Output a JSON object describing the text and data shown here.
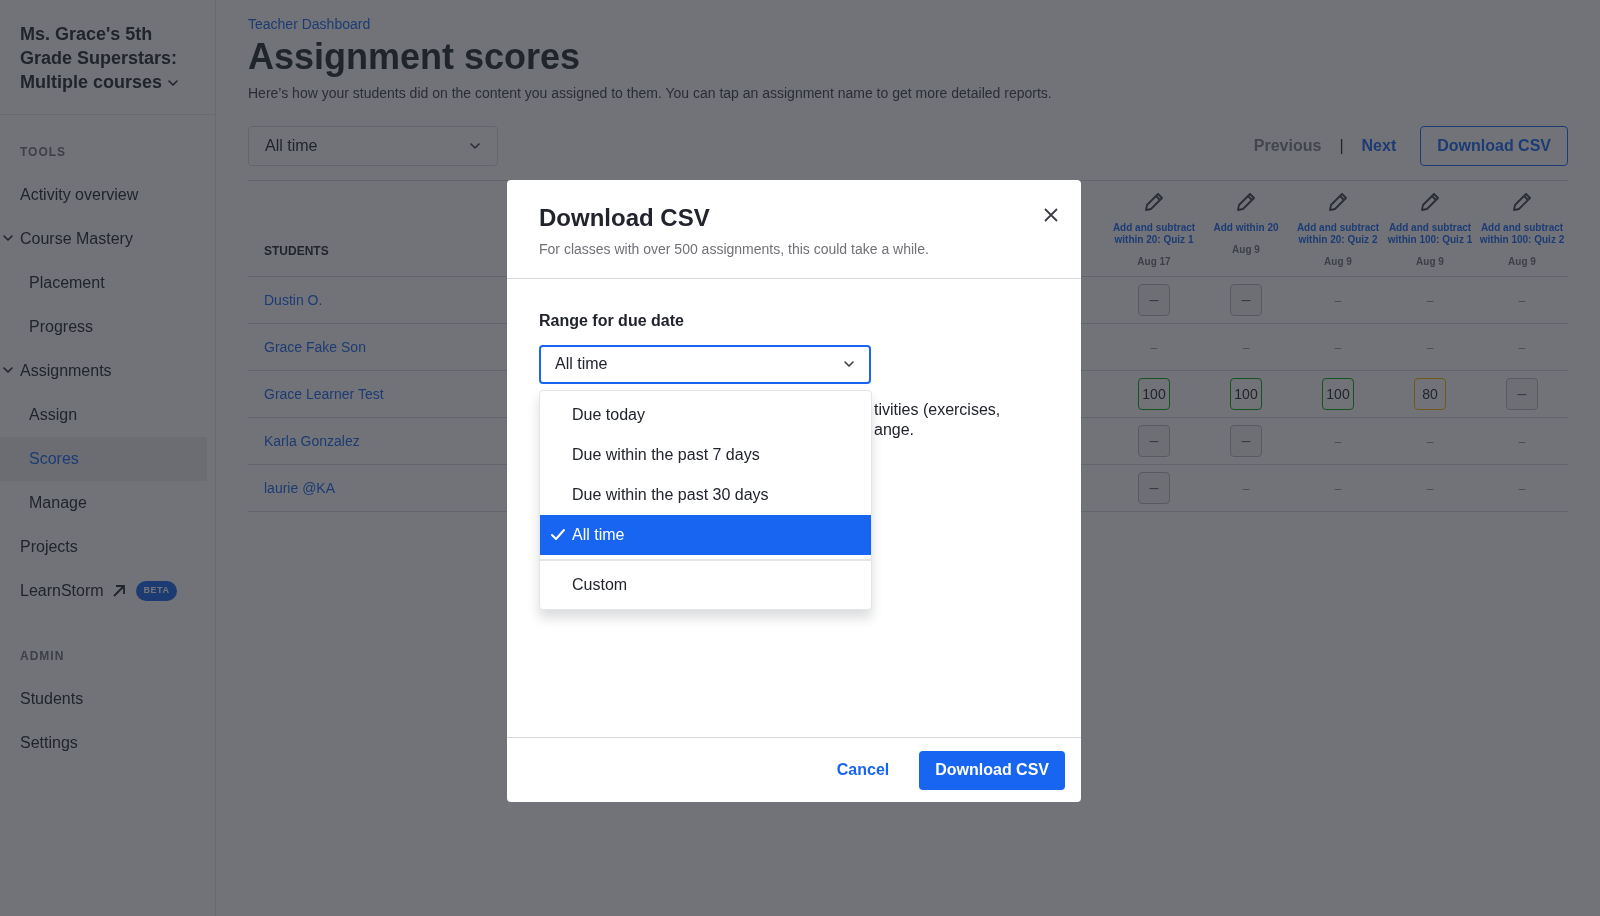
{
  "sidebar": {
    "class_name": "Ms. Grace's 5th Grade Superstars: Multiple courses",
    "sections": [
      {
        "heading": "TOOLS",
        "items": [
          {
            "label": "Activity overview",
            "selected": false,
            "external": false
          },
          {
            "label": "Course Mastery",
            "selected": false,
            "external": false,
            "expanded": true,
            "children": [
              {
                "label": "Placement",
                "selected": false
              },
              {
                "label": "Progress",
                "selected": false
              }
            ]
          },
          {
            "label": "Assignments",
            "selected": false,
            "external": false,
            "expanded": true,
            "children": [
              {
                "label": "Assign",
                "selected": false
              },
              {
                "label": "Scores",
                "selected": true
              },
              {
                "label": "Manage",
                "selected": false
              }
            ]
          },
          {
            "label": "Projects",
            "selected": false,
            "external": false
          },
          {
            "label": "LearnStorm",
            "selected": false,
            "external": true,
            "badge": "BETA"
          }
        ]
      },
      {
        "heading": "ADMIN",
        "items": [
          {
            "label": "Students",
            "selected": false,
            "external": false
          },
          {
            "label": "Settings",
            "selected": false,
            "external": false
          }
        ]
      }
    ]
  },
  "breadcrumb": "Teacher Dashboard",
  "title": "Assignment scores",
  "description": "Here’s how your students did on the content you assigned to them. You can tap an assignment name to get more detailed reports.",
  "filter": {
    "value": "All time"
  },
  "pager": {
    "previous": {
      "label": "Previous",
      "disabled": true
    },
    "separator": "|",
    "next": {
      "label": "Next",
      "disabled": false
    }
  },
  "download_button": "Download CSV",
  "table": {
    "student_heading": "STUDENTS",
    "columns": [
      {
        "title": "Add and subtract within 20: Quiz 1",
        "date": "Aug 17"
      },
      {
        "title": "Add within 20",
        "date": "Aug 9"
      },
      {
        "title": "Add and subtract within 20: Quiz 2",
        "date": "Aug 9"
      },
      {
        "title": "Add and subtract within 100: Quiz 1",
        "date": "Aug 9"
      },
      {
        "title": "Add and subtract within 100: Quiz 2",
        "date": "Aug 9"
      }
    ],
    "rows": [
      {
        "student": "Dustin O.",
        "cells": [
          {
            "kind": "empty",
            "text": "–"
          },
          {
            "kind": "empty",
            "text": "–"
          },
          {
            "kind": "none",
            "text": "–"
          },
          {
            "kind": "none",
            "text": "–"
          },
          {
            "kind": "none",
            "text": "–"
          }
        ]
      },
      {
        "student": "Grace Fake Son",
        "cells": [
          {
            "kind": "none",
            "text": "–"
          },
          {
            "kind": "none",
            "text": "–"
          },
          {
            "kind": "none",
            "text": "–"
          },
          {
            "kind": "none",
            "text": "–"
          },
          {
            "kind": "none",
            "text": "–"
          }
        ]
      },
      {
        "student": "Grace Learner Test",
        "cells": [
          {
            "kind": "pass",
            "text": "100"
          },
          {
            "kind": "pass",
            "text": "100"
          },
          {
            "kind": "pass",
            "text": "100"
          },
          {
            "kind": "partial",
            "text": "80"
          },
          {
            "kind": "empty",
            "text": "–"
          }
        ]
      },
      {
        "student": "Karla Gonzalez",
        "cells": [
          {
            "kind": "empty",
            "text": "–"
          },
          {
            "kind": "empty",
            "text": "–"
          },
          {
            "kind": "none",
            "text": "–"
          },
          {
            "kind": "none",
            "text": "–"
          },
          {
            "kind": "none",
            "text": "–"
          }
        ]
      },
      {
        "student": "laurie @KA",
        "cells": [
          {
            "kind": "empty",
            "text": "–"
          },
          {
            "kind": "none",
            "text": "–"
          },
          {
            "kind": "none",
            "text": "–"
          },
          {
            "kind": "none",
            "text": "–"
          },
          {
            "kind": "none",
            "text": "–"
          }
        ]
      }
    ]
  },
  "modal": {
    "title": "Download CSV",
    "subtitle": "For classes with over 500 assignments, this could take a while.",
    "field_label": "Range for due date",
    "field_value": "All time",
    "option_groups": [
      [
        {
          "label": "Due today",
          "selected": false
        },
        {
          "label": "Due within the past 7 days",
          "selected": false
        },
        {
          "label": "Due within the past 30 days",
          "selected": false
        },
        {
          "label": "All time",
          "selected": true
        }
      ],
      [
        {
          "label": "Custom",
          "selected": false
        }
      ]
    ],
    "note_lines": [
      "tivities (exercises,",
      "ange."
    ],
    "cancel": "Cancel",
    "confirm": "Download CSV"
  }
}
